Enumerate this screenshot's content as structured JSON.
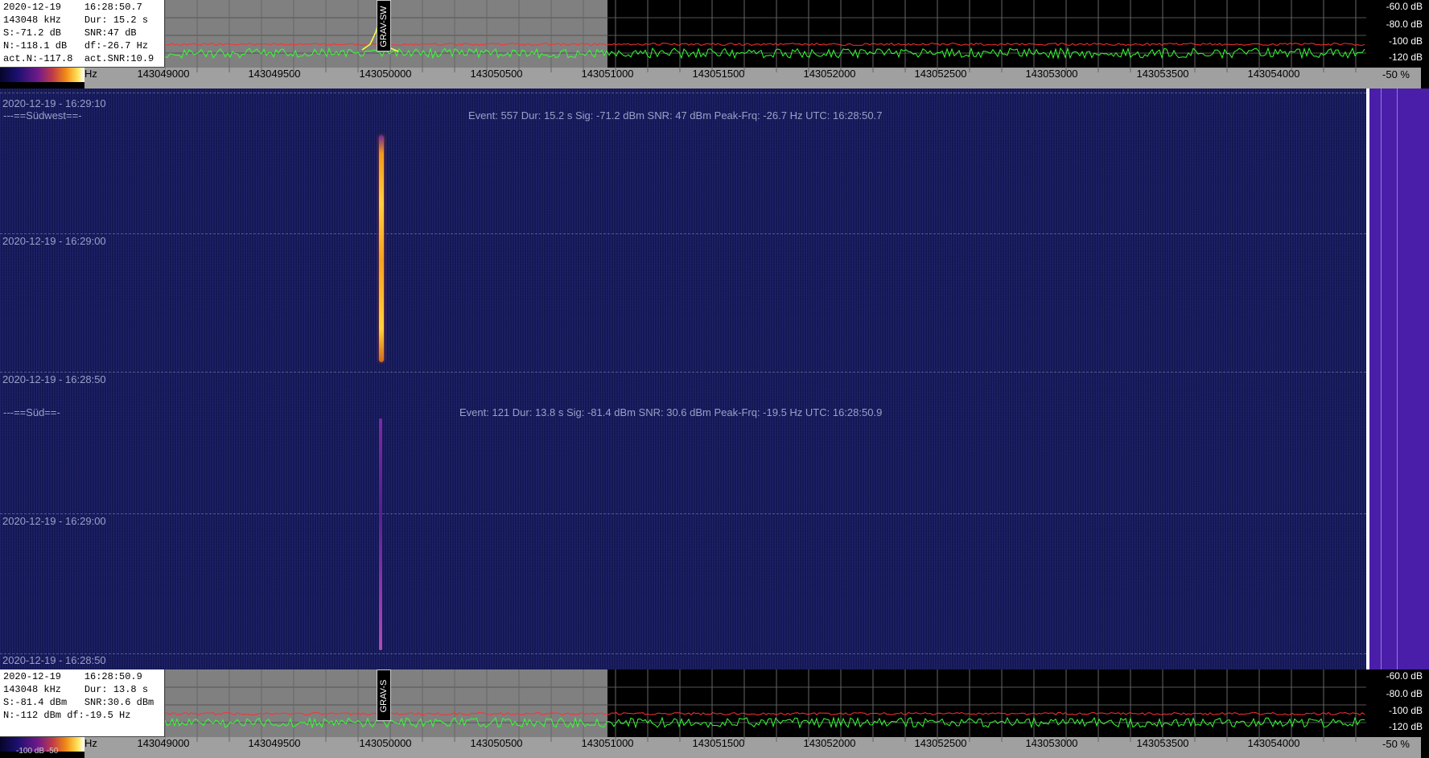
{
  "top_panel": {
    "info_lines": [
      "2020-12-19    16:28:50.7",
      "143048 kHz    Dur: 15.2 s",
      "S:-71.2 dB    SNR:47 dB",
      "N:-118.1 dB   df:-26.7 Hz",
      "act.N:-117.8  act.SNR:10.9"
    ],
    "axis_hz_label": "Hz",
    "marker": "GRAV-SW",
    "db_labels": [
      "-60.0 dB",
      "-80.0 dB",
      "-100 dB",
      "-120 dB"
    ],
    "percent": "-50 %"
  },
  "bottom_panel": {
    "info_lines": [
      "2020-12-19    16:28:50.9",
      "143048 kHz    Dur: 13.8 s",
      "S:-81.4 dBm   SNR:30.6 dBm",
      "N:-112 dBm df:-19.5 Hz"
    ],
    "axis_hz_label": "Hz",
    "colorbar_label": "-100 dB        -50",
    "marker": "GRAV-S",
    "db_labels": [
      "-60.0 dB",
      "-80.0 dB",
      "-100 dB",
      "-120 dB"
    ],
    "percent": "-50 %"
  },
  "freq_ticks": [
    "143049000",
    "143049500",
    "143050000",
    "143050500",
    "143051000",
    "143051500",
    "143052000",
    "143052500",
    "143053000",
    "143053500",
    "143054000"
  ],
  "waterfall": {
    "timestamps": [
      "2020-12-19 - 16:29:10",
      "2020-12-19 - 16:29:00",
      "2020-12-19 - 16:28:50",
      "2020-12-19 - 16:29:00",
      "2020-12-19 - 16:28:50"
    ],
    "stations": [
      "---==Südwest==-",
      "---==Süd==-"
    ],
    "events": [
      "Event: 557   Dur: 15.2 s   Sig: -71.2 dBm   SNR: 47 dBm   Peak-Frq: -26.7 Hz   UTC: 16:28:50.7",
      "Event: 121   Dur: 13.8 s   Sig: -81.4 dBm   SNR: 30.6 dBm   Peak-Frq: -19.5 Hz   UTC: 16:28:50.9"
    ]
  },
  "colors": {
    "noise_trace": "#33ff33",
    "threshold": "#ff3030",
    "peak_trace": "#ffff40",
    "waterfall_bg": "#171b5c"
  }
}
